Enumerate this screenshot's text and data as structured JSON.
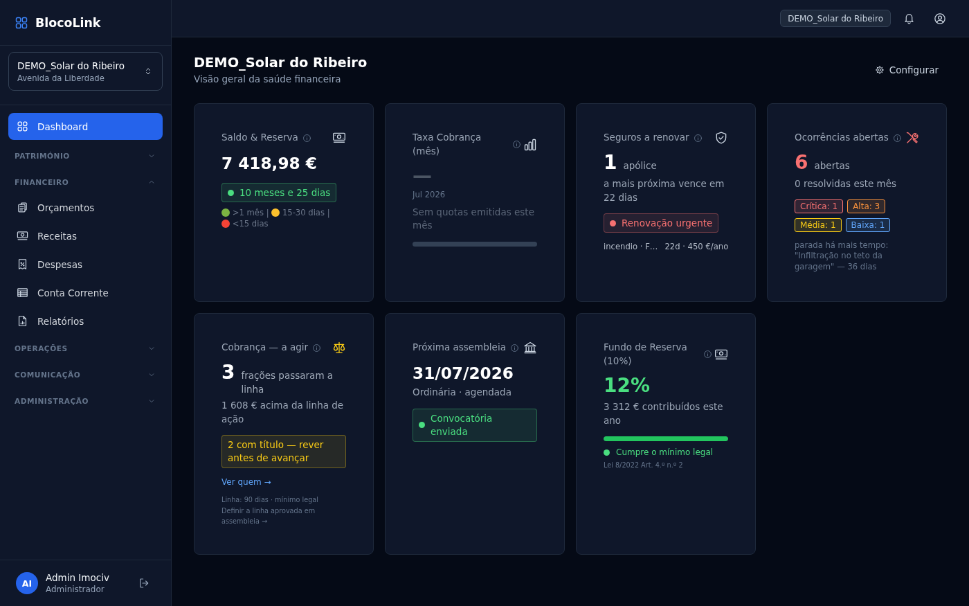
{
  "sidebar": {
    "brand": "BlocoLink",
    "property": {
      "name": "DEMO_Solar do Ribeiro",
      "address": "Avenida da Liberdade"
    },
    "nav": [
      {
        "kind": "link",
        "label": "Dashboard",
        "selected": true
      },
      {
        "kind": "group",
        "label": "PATRIMÓNIO",
        "expanded": false
      },
      {
        "kind": "group",
        "label": "FINANCEIRO",
        "expanded": true,
        "children": [
          {
            "label": "Orçamentos",
            "selected": false
          },
          {
            "label": "Receitas",
            "selected": false
          },
          {
            "label": "Despesas",
            "selected": false
          },
          {
            "label": "Conta Corrente",
            "selected": false
          },
          {
            "label": "Relatórios",
            "selected": false
          }
        ]
      },
      {
        "kind": "group",
        "label": "OPERAÇÕES",
        "expanded": false
      },
      {
        "kind": "group",
        "label": "COMUNICAÇÃO",
        "expanded": false
      },
      {
        "kind": "group",
        "label": "ADMINISTRAÇÃO",
        "expanded": false
      }
    ],
    "user": {
      "initials": "AI",
      "name": "Admin Imociv",
      "role": "Administrador"
    }
  },
  "topbar": {
    "property_chip": "DEMO_Solar do Ribeiro"
  },
  "header": {
    "title": "DEMO_Solar do Ribeiro",
    "subtitle": "Visão geral da saúde financeira",
    "action": "Configurar"
  },
  "cards": [
    {
      "title": "Saldo & Reserva",
      "body": [
        {
          "kind": "value",
          "text": "7 418,98 €",
          "color": "#ffffff"
        },
        {
          "kind": "badge",
          "text": "10 meses e 25 dias",
          "color": "#4ade80",
          "dot": true
        },
        {
          "kind": "legend",
          "separator": "|",
          "items": [
            {
              "color": "#7cb342",
              "label": ">1 mês"
            },
            {
              "color": "#fbc02d",
              "label": "15-30 dias"
            },
            {
              "color": "#f44336",
              "label": "<15 dias"
            }
          ]
        }
      ]
    },
    {
      "title": "Taxa Cobrança (mês)",
      "body": [
        {
          "kind": "count",
          "text": "—",
          "color": "#4b5563"
        },
        {
          "kind": "caption",
          "text": "Jul 2026"
        },
        {
          "kind": "hint",
          "text": "Sem quotas emitidas este mês"
        },
        {
          "kind": "progress"
        }
      ]
    },
    {
      "title": "Seguros a renovar",
      "body": [
        {
          "kind": "count",
          "text": "1",
          "unit": "apólice",
          "color": "#ffffff"
        },
        {
          "kind": "text",
          "text": "a mais próxima vence em 22 dias"
        },
        {
          "kind": "badge",
          "text": "Renovação urgente",
          "color": "#f87171",
          "dot": true
        },
        {
          "kind": "meta",
          "parts": [
            "incendio · F…",
            "22d · 450 €/ano"
          ]
        }
      ]
    },
    {
      "title": "Ocorrências abertas",
      "body": [
        {
          "kind": "count",
          "text": "6",
          "unit": "abertas",
          "color": "#f87171"
        },
        {
          "kind": "text",
          "text": "0 resolvidas este mês"
        },
        {
          "kind": "tags",
          "items": [
            {
              "label": "Crítica: 1",
              "color": "#f87171"
            },
            {
              "label": "Alta: 3",
              "color": "#fb923c"
            },
            {
              "label": "Média: 1",
              "color": "#facc15"
            },
            {
              "label": "Baixa: 1",
              "color": "#60a5fa"
            }
          ]
        },
        {
          "kind": "caption",
          "text": "parada há mais tempo: \"Infiltração no teto da garagem\" — 36 dias"
        }
      ]
    },
    {
      "title": "Cobrança — a agir",
      "body": [
        {
          "kind": "count",
          "text": "3",
          "unit": "frações passaram a linha",
          "color": "#ffffff"
        },
        {
          "kind": "text",
          "text": "1 608 € acima da linha de ação"
        },
        {
          "kind": "callout",
          "text": "2 com título — rever antes de avançar",
          "color": "#facc15",
          "dot": false
        },
        {
          "kind": "link",
          "text": "Ver quem →"
        },
        {
          "kind": "fine",
          "text": "Linha: 90 dias · mínimo legal"
        },
        {
          "kind": "footlink",
          "text": "Definir a linha aprovada em assembleia →"
        }
      ]
    },
    {
      "title": "Próxima assembleia",
      "body": [
        {
          "kind": "value",
          "text": "31/07/2026",
          "color": "#ffffff"
        },
        {
          "kind": "text",
          "text": "Ordinária · agendada"
        },
        {
          "kind": "callout",
          "text": "Convocatória enviada",
          "color": "#4ade80",
          "dot": true
        }
      ]
    },
    {
      "title": "Fundo de Reserva (10%)",
      "body": [
        {
          "kind": "count",
          "text": "12%",
          "color": "#4ade80"
        },
        {
          "kind": "text",
          "text": "3 312 € contribuídos este ano"
        },
        {
          "kind": "progress",
          "level": 1,
          "color": "#22c55e"
        },
        {
          "kind": "status",
          "text": "Cumpre o mínimo legal",
          "color": "#4ade80"
        },
        {
          "kind": "fine",
          "text": "Lei 8/2022 Art. 4.º n.º 2"
        }
      ]
    }
  ]
}
